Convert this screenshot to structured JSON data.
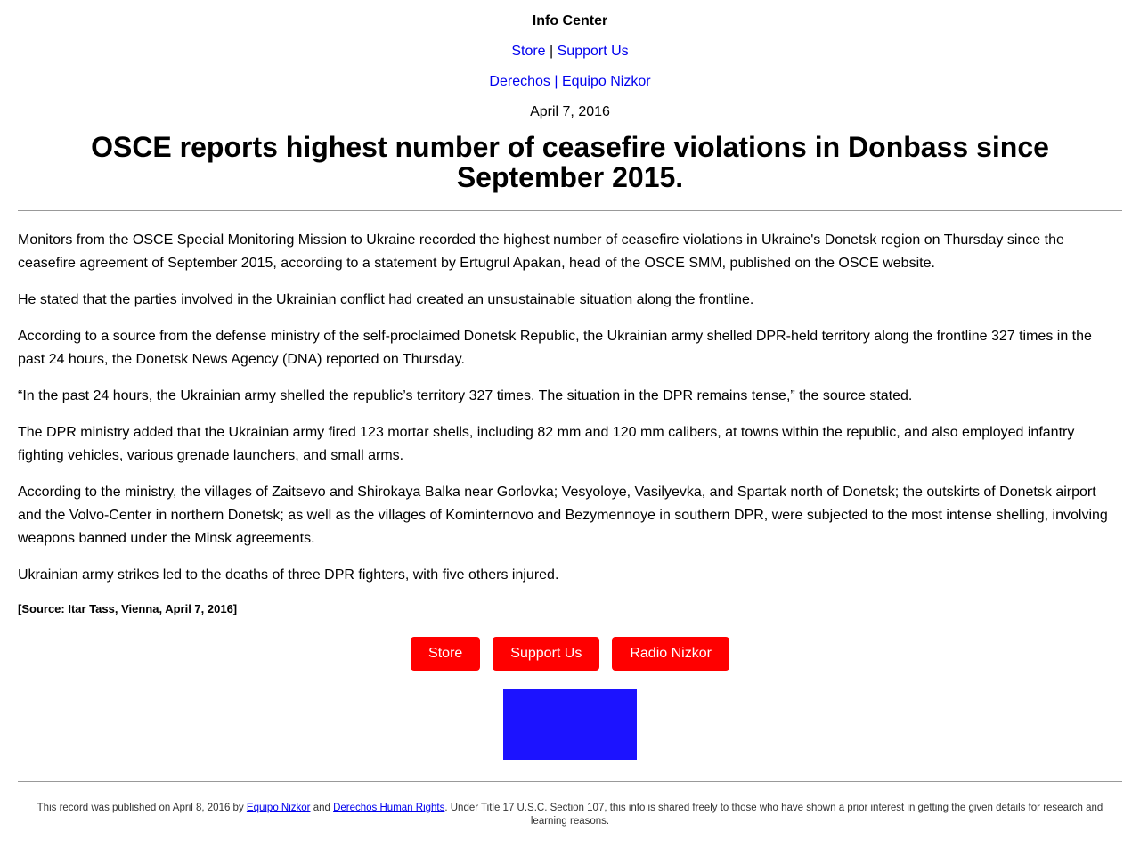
{
  "header": {
    "title": "Info Center",
    "nav1": {
      "store": "Store",
      "sep": " | ",
      "support": "Support Us"
    },
    "nav2": {
      "derechos": "Derechos",
      "sep": " | ",
      "nizkor": "Equipo Nizkor"
    },
    "date": "April 7, 2016"
  },
  "article": {
    "headline": "OSCE reports highest number of ceasefire violations in Donbass since September 2015.",
    "paragraphs": [
      "Monitors from the OSCE Special Monitoring Mission to Ukraine recorded the highest number of ceasefire violations in Ukraine's Donetsk region on Thursday since the ceasefire agreement of September 2015, according to a statement by Ertugrul Apakan, head of the OSCE SMM, published on the OSCE website.",
      "He stated that the parties involved in the Ukrainian conflict had created an unsustainable situation along the frontline.",
      "According to a source from the defense ministry of the self-proclaimed Donetsk Republic, the Ukrainian army shelled DPR-held territory along the frontline 327 times in the past 24 hours, the Donetsk News Agency (DNA) reported on Thursday.",
      "“In the past 24 hours, the Ukrainian army shelled the republic’s territory 327 times. The situation in the DPR remains tense,” the source stated.",
      "The DPR ministry added that the Ukrainian army fired 123 mortar shells, including 82 mm and 120 mm calibers, at towns within the republic, and also employed infantry fighting vehicles, various grenade launchers, and small arms.",
      "According to the ministry, the villages of Zaitsevo and Shirokaya Balka near Gorlovka; Vesyoloye, Vasilyevka, and Spartak north of Donetsk; the outskirts of Donetsk airport and the Volvo-Center in northern Donetsk; as well as the villages of Kominternovo and Bezymennoye in southern DPR, were subjected to the most intense shelling, involving weapons banned under the Minsk agreements.",
      "Ukrainian army strikes led to the deaths of three DPR fighters, with five others injured."
    ],
    "source": "[Source: Itar Tass, Vienna, April 7, 2016]"
  },
  "buttons": {
    "store": "Store",
    "support": "Support Us",
    "radio": "Radio Nizkor"
  },
  "banner": {
    "color": "#1c13ff"
  },
  "footer": {
    "part1": "This record was published on April 8, 2016 by ",
    "link1": "Equipo Nizkor",
    "part2": " and ",
    "link2": "Derechos Human Rights",
    "part3": ". Under Title 17 U.S.C. Section 107, this info is shared freely to those who have shown a prior interest in getting the given details for research and learning reasons."
  },
  "colors": {
    "link": "#0000ee",
    "button_bg": "#ff0000",
    "button_text": "#ffffff"
  }
}
